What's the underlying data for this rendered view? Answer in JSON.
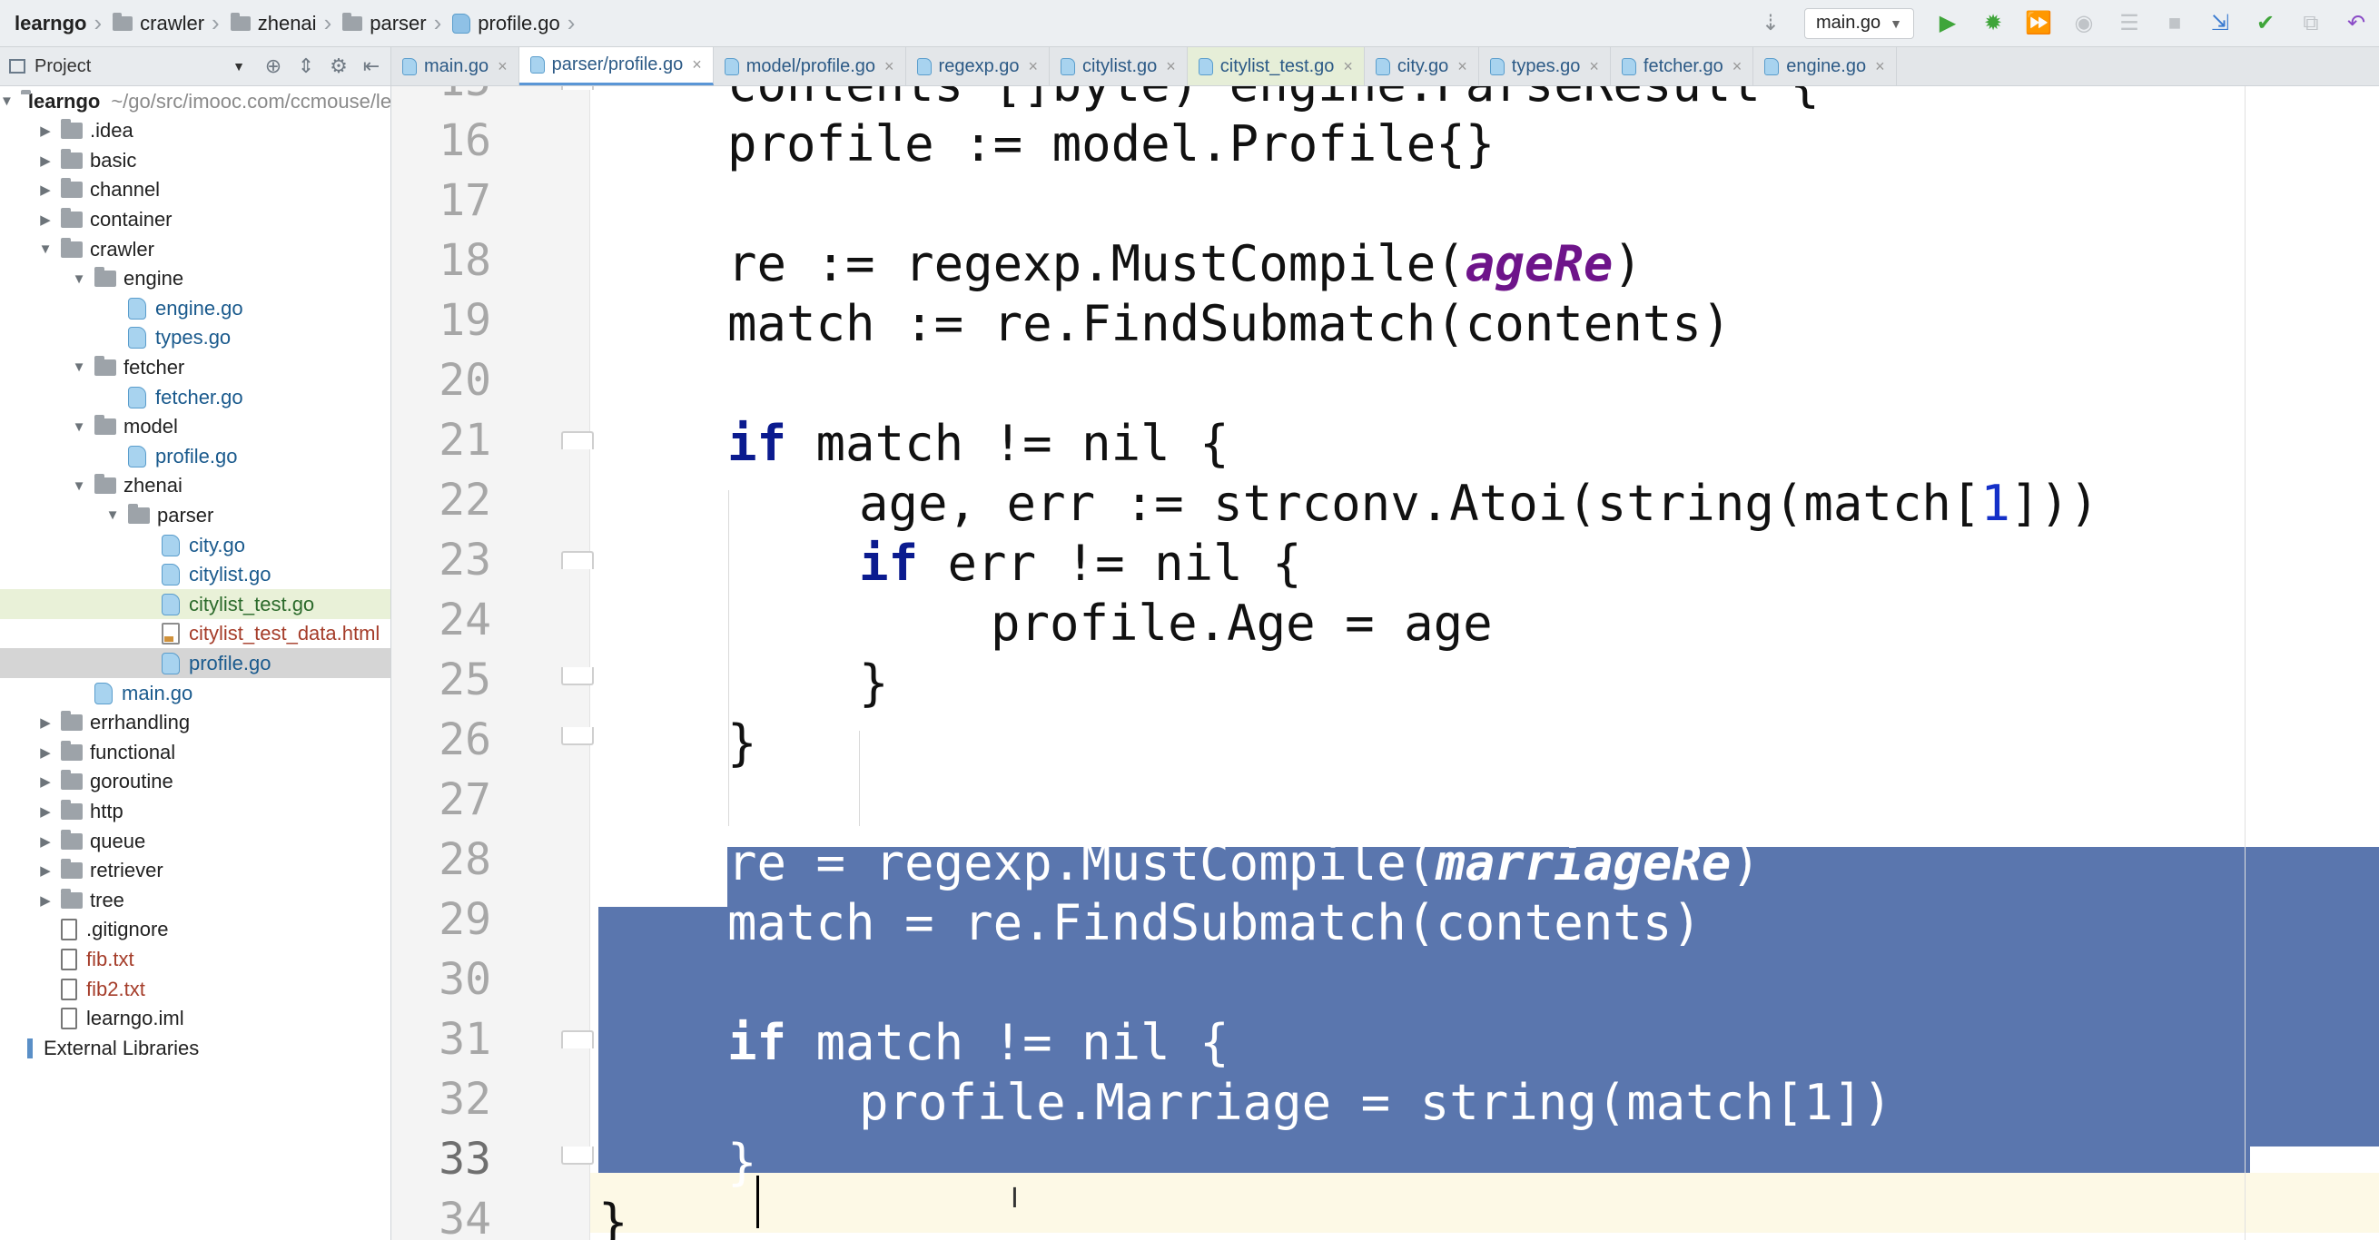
{
  "navbar": {
    "crumbs": [
      {
        "label": "learngo",
        "icon": "none"
      },
      {
        "label": "crawler",
        "icon": "folder-icon"
      },
      {
        "label": "zhenai",
        "icon": "folder-icon"
      },
      {
        "label": "parser",
        "icon": "folder-icon"
      },
      {
        "label": "profile.go",
        "icon": "go-file-icon"
      }
    ],
    "run_config": "main.go"
  },
  "project": {
    "header_label": "Project",
    "tree": [
      {
        "label": "learngo",
        "suffix": "~/go/src/imooc.com/ccmouse/learngo",
        "icon": "folder",
        "depth": 0,
        "arrow": "open",
        "bold": true
      },
      {
        "label": ".idea",
        "icon": "folder",
        "depth": 1,
        "arrow": "closed"
      },
      {
        "label": "basic",
        "icon": "folder",
        "depth": 1,
        "arrow": "closed"
      },
      {
        "label": "channel",
        "icon": "folder",
        "depth": 1,
        "arrow": "closed"
      },
      {
        "label": "container",
        "icon": "folder",
        "depth": 1,
        "arrow": "closed"
      },
      {
        "label": "crawler",
        "icon": "folder",
        "depth": 1,
        "arrow": "open"
      },
      {
        "label": "engine",
        "icon": "folder",
        "depth": 2,
        "arrow": "open"
      },
      {
        "label": "engine.go",
        "icon": "go",
        "depth": 3
      },
      {
        "label": "types.go",
        "icon": "go",
        "depth": 3
      },
      {
        "label": "fetcher",
        "icon": "folder",
        "depth": 2,
        "arrow": "open"
      },
      {
        "label": "fetcher.go",
        "icon": "go",
        "depth": 3
      },
      {
        "label": "model",
        "icon": "folder",
        "depth": 2,
        "arrow": "open"
      },
      {
        "label": "profile.go",
        "icon": "go",
        "depth": 3
      },
      {
        "label": "zhenai",
        "icon": "folder",
        "depth": 2,
        "arrow": "open"
      },
      {
        "label": "parser",
        "icon": "folder",
        "depth": 3,
        "arrow": "open"
      },
      {
        "label": "city.go",
        "icon": "go",
        "depth": 4
      },
      {
        "label": "citylist.go",
        "icon": "go",
        "depth": 4
      },
      {
        "label": "citylist_test.go",
        "icon": "go",
        "depth": 4,
        "state": "highlight"
      },
      {
        "label": "citylist_test_data.html",
        "icon": "html",
        "depth": 4,
        "color": "err"
      },
      {
        "label": "profile.go",
        "icon": "go",
        "depth": 4,
        "state": "selected"
      },
      {
        "label": "main.go",
        "icon": "go",
        "depth": 2
      },
      {
        "label": "errhandling",
        "icon": "folder",
        "depth": 1,
        "arrow": "closed"
      },
      {
        "label": "functional",
        "icon": "folder",
        "depth": 1,
        "arrow": "closed"
      },
      {
        "label": "goroutine",
        "icon": "folder",
        "depth": 1,
        "arrow": "closed"
      },
      {
        "label": "http",
        "icon": "folder",
        "depth": 1,
        "arrow": "closed"
      },
      {
        "label": "queue",
        "icon": "folder",
        "depth": 1,
        "arrow": "closed"
      },
      {
        "label": "retriever",
        "icon": "folder",
        "depth": 1,
        "arrow": "closed"
      },
      {
        "label": "tree",
        "icon": "folder",
        "depth": 1,
        "arrow": "closed"
      },
      {
        "label": ".gitignore",
        "icon": "txt",
        "depth": 1
      },
      {
        "label": "fib.txt",
        "icon": "txt",
        "depth": 1,
        "color": "err"
      },
      {
        "label": "fib2.txt",
        "icon": "txt",
        "depth": 1,
        "color": "err"
      },
      {
        "label": "learngo.iml",
        "icon": "txt",
        "depth": 1
      },
      {
        "label": "External Libraries",
        "icon": "lib",
        "depth": 0
      }
    ]
  },
  "tabs": [
    {
      "label": "main.go",
      "active": false
    },
    {
      "label": "parser/profile.go",
      "active": true
    },
    {
      "label": "model/profile.go",
      "active": false
    },
    {
      "label": "regexp.go",
      "active": false
    },
    {
      "label": "citylist.go",
      "active": false
    },
    {
      "label": "citylist_test.go",
      "active": false,
      "tint": "green"
    },
    {
      "label": "city.go",
      "active": false
    },
    {
      "label": "types.go",
      "active": false
    },
    {
      "label": "fetcher.go",
      "active": false
    },
    {
      "label": "engine.go",
      "active": false
    }
  ],
  "editor": {
    "lines": [
      {
        "n": "15",
        "indent": 0,
        "fold": "open",
        "tokens": [
          {
            "t": "contents []byte) engine.ParseResult {"
          }
        ]
      },
      {
        "n": "16",
        "indent": 0,
        "tokens": [
          {
            "t": "profile := model.Profile{}"
          }
        ]
      },
      {
        "n": "17",
        "indent": 0,
        "tokens": []
      },
      {
        "n": "18",
        "indent": 0,
        "tokens": [
          {
            "t": "re := regexp.MustCompile("
          },
          {
            "t": "ageRe",
            "c": "ital"
          },
          {
            "t": ")"
          }
        ]
      },
      {
        "n": "19",
        "indent": 0,
        "tokens": [
          {
            "t": "match := re.FindSubmatch(contents)"
          }
        ]
      },
      {
        "n": "20",
        "indent": 0,
        "tokens": []
      },
      {
        "n": "21",
        "indent": 0,
        "fold": "open",
        "tokens": [
          {
            "t": "if",
            "c": "kw"
          },
          {
            "t": " match != nil {"
          }
        ]
      },
      {
        "n": "22",
        "indent": 1,
        "tokens": [
          {
            "t": "age, err := strconv.Atoi(string(match["
          },
          {
            "t": "1",
            "c": "num"
          },
          {
            "t": "]))"
          }
        ]
      },
      {
        "n": "23",
        "indent": 1,
        "fold": "open",
        "tokens": [
          {
            "t": "if",
            "c": "kw"
          },
          {
            "t": " err != nil {"
          }
        ]
      },
      {
        "n": "24",
        "indent": 2,
        "tokens": [
          {
            "t": "profile.Age = age"
          }
        ]
      },
      {
        "n": "25",
        "indent": 1,
        "fold": "close",
        "tokens": [
          {
            "t": "}"
          }
        ]
      },
      {
        "n": "26",
        "indent": 0,
        "fold": "close",
        "tokens": [
          {
            "t": "}"
          }
        ]
      },
      {
        "n": "27",
        "indent": 0,
        "tokens": []
      },
      {
        "n": "28",
        "indent": 0,
        "sel": true,
        "tokens": [
          {
            "t": "re = regexp.MustCompile("
          },
          {
            "t": "marriageRe",
            "c": "ital"
          },
          {
            "t": ")"
          }
        ]
      },
      {
        "n": "29",
        "indent": 0,
        "sel": true,
        "tokens": [
          {
            "t": "match = re.FindSubmatch(contents)"
          }
        ]
      },
      {
        "n": "30",
        "indent": 0,
        "sel": true,
        "tokens": []
      },
      {
        "n": "31",
        "indent": 0,
        "sel": true,
        "fold": "open",
        "tokens": [
          {
            "t": "if",
            "c": "kw"
          },
          {
            "t": " match != nil {"
          }
        ]
      },
      {
        "n": "32",
        "indent": 1,
        "sel": true,
        "tokens": [
          {
            "t": "profile.Marriage = string(match[1])"
          }
        ]
      },
      {
        "n": "33",
        "indent": 0,
        "sel": true,
        "cur": true,
        "fold": "close",
        "tokens": [
          {
            "t": "}"
          }
        ]
      },
      {
        "n": "34",
        "indent": -1,
        "tokens": [
          {
            "t": "}"
          }
        ]
      }
    ]
  },
  "colors": {
    "selection": "#5a76ae",
    "keyword": "#0b1b8f",
    "italic_ident": "#6e148a",
    "number": "#1430c8",
    "tab_accent": "#5a96d6"
  }
}
